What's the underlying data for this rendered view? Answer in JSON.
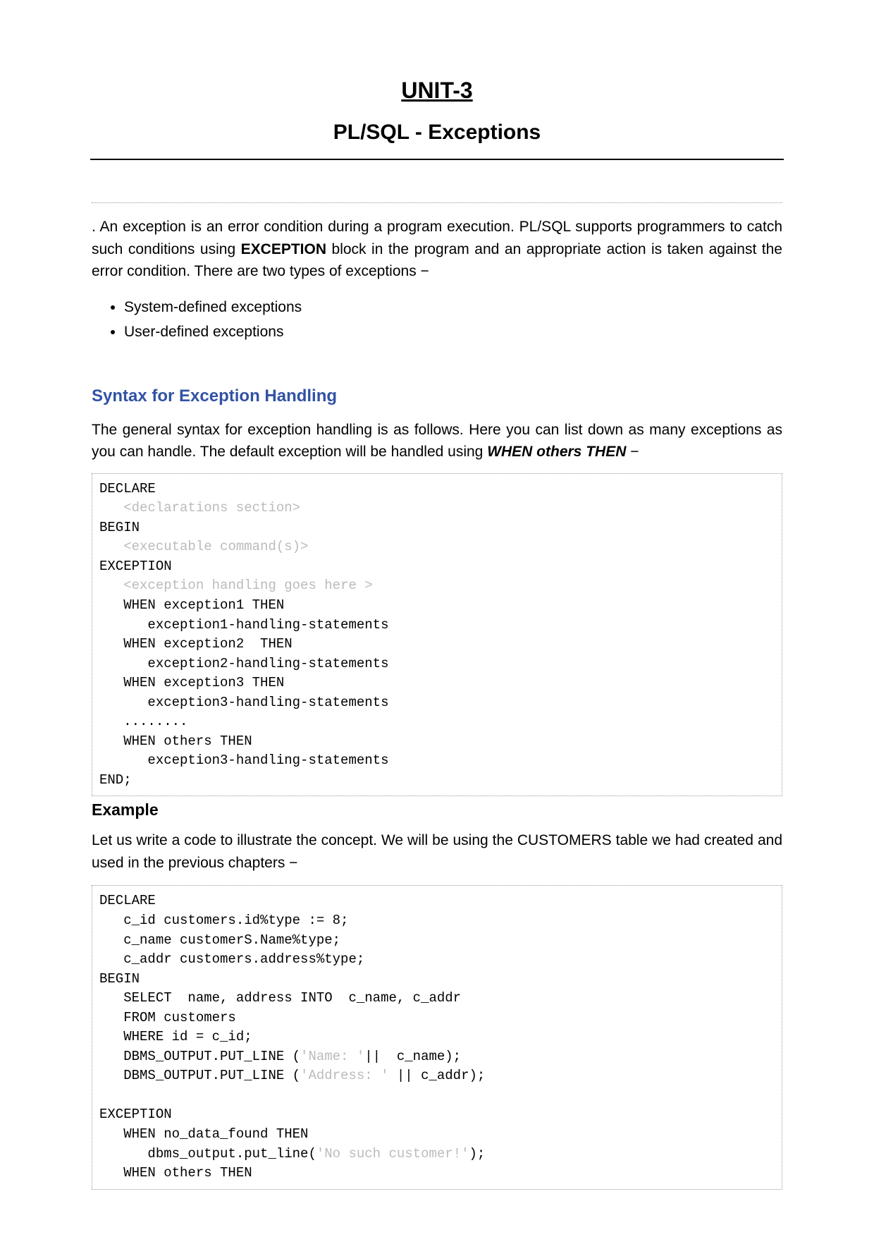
{
  "header": {
    "unit": "UNIT-3",
    "title": "PL/SQL - Exceptions"
  },
  "intro": {
    "prefix": ". An exception is an error condition during a program execution. PL/SQL supports programmers to catch such conditions using ",
    "bold": "EXCEPTION",
    "suffix": " block in the program and an appropriate action is taken against the error condition. There are two types of exceptions −"
  },
  "exception_types": [
    "System-defined exceptions",
    "User-defined exceptions"
  ],
  "syntax": {
    "heading": "Syntax for Exception Handling",
    "para_prefix": "The general syntax for exception handling is as follows. Here you can list down as many exceptions as you can handle. The default exception will be handled using ",
    "para_em": "WHEN others THEN",
    "para_suffix": " −",
    "code_plain1": "DECLARE \n   ",
    "code_gray1": "<declarations section>",
    "code_plain2": " \nBEGIN \n   ",
    "code_gray2": "<executable command(s)>",
    "code_plain3": " \nEXCEPTION \n   ",
    "code_gray3": "<exception handling goes here >",
    "code_plain4": " \n   WHEN exception1 THEN  \n      exception1-handling-statements  \n   WHEN exception2  THEN  \n      exception2-handling-statements  \n   WHEN exception3 THEN  \n      exception3-handling-statements \n   ........ \n   WHEN others THEN \n      exception3-handling-statements \nEND;"
  },
  "example": {
    "heading": "Example",
    "para": "Let us write a code to illustrate the concept. We will be using the CUSTOMERS table we had created and used in the previous chapters −",
    "code_p1": "DECLARE \n   c_id customers.id%type := 8; \n   c_name customerS.Name%type; \n   c_addr customers.address%type; \nBEGIN \n   SELECT  name, address INTO  c_name, c_addr \n   FROM customers \n   WHERE id = c_id;  \n   DBMS_OUTPUT.PUT_LINE (",
    "code_g1": "'Name: '",
    "code_p2": "||  c_name); \n   DBMS_OUTPUT.PUT_LINE (",
    "code_g2": "'Address: '",
    "code_p3": " || c_addr); \n\nEXCEPTION \n   WHEN no_data_found THEN \n      dbms_output.put_line(",
    "code_g3": "'No such customer!'",
    "code_p4": "); \n   WHEN others THEN "
  }
}
